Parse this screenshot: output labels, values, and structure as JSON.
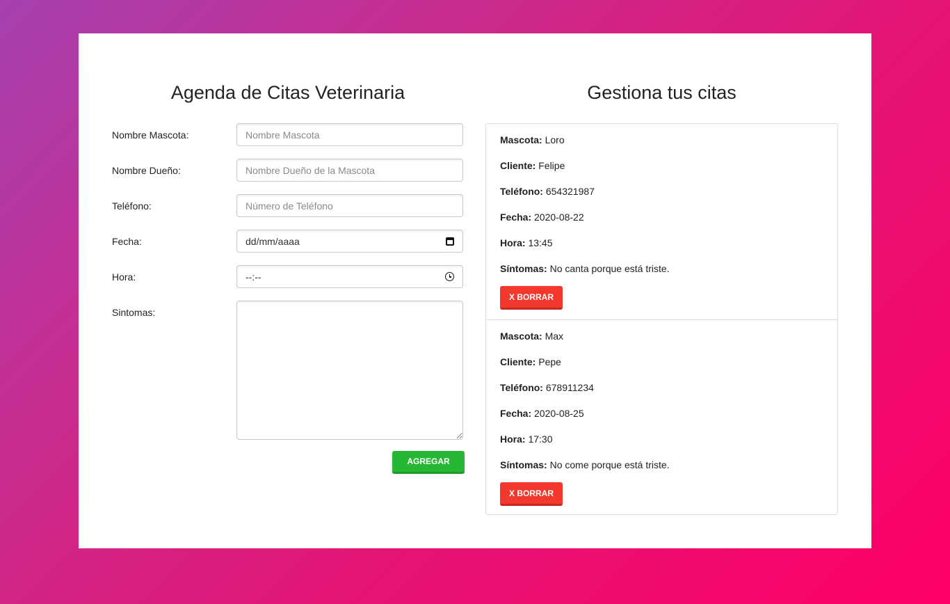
{
  "form": {
    "title": "Agenda de Citas Veterinaria",
    "fields": [
      {
        "label": "Nombre Mascota:",
        "placeholder": "Nombre Mascota"
      },
      {
        "label": "Nombre Dueño:",
        "placeholder": "Nombre Dueño de la Mascota"
      },
      {
        "label": "Teléfono:",
        "placeholder": "Número de Teléfono"
      },
      {
        "label": "Fecha:",
        "value": "dd/mm/aaaa"
      },
      {
        "label": "Hora:",
        "value": "--:--"
      },
      {
        "label": "Sintomas:",
        "placeholder": ""
      }
    ],
    "submit_label": "AGREGAR"
  },
  "appointments": {
    "title": "Gestiona tus citas",
    "labels": {
      "pet": "Mascota:",
      "client": "Cliente:",
      "phone": "Teléfono:",
      "date": "Fecha:",
      "time": "Hora:",
      "symptoms": "Síntomas:"
    },
    "delete_label": "X BORRAR",
    "items": [
      {
        "pet": "Loro",
        "client": "Felipe",
        "phone": "654321987",
        "date": "2020-08-22",
        "time": "13:45",
        "symptoms": "No canta porque está triste."
      },
      {
        "pet": "Max",
        "client": "Pepe",
        "phone": "678911234",
        "date": "2020-08-25",
        "time": "17:30",
        "symptoms": "No come porque está triste."
      }
    ]
  },
  "colors": {
    "add_button": "#27b734",
    "delete_button": "#f3382d",
    "background_start": "#a541b0",
    "background_end": "#ff0066"
  },
  "icons": [
    "calendar-icon",
    "clock-icon"
  ]
}
